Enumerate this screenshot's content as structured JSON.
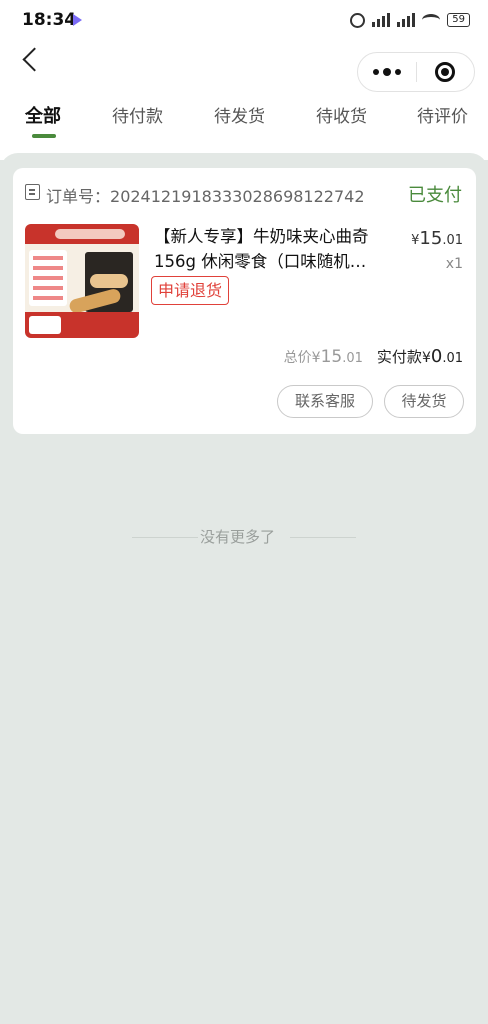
{
  "status_bar": {
    "time": "18:34",
    "battery": "59"
  },
  "tabs": [
    {
      "label": "全部",
      "active": true
    },
    {
      "label": "待付款",
      "active": false
    },
    {
      "label": "待发货",
      "active": false
    },
    {
      "label": "待收货",
      "active": false
    },
    {
      "label": "待评价",
      "active": false
    }
  ],
  "order": {
    "order_no_label": "订单号：",
    "order_no": "20241219183330286981227​42",
    "status": "已支付",
    "product_title": "【新人专享】牛奶味夹心曲奇156g 休闲零食（口味随机…",
    "price_symbol": "¥",
    "price_int": "15",
    "price_dec": ".01",
    "quantity": "x1",
    "refund_label": "申请退货",
    "total_label": "总价",
    "total_symbol": "¥",
    "total_int": "15",
    "total_dec": ".01",
    "paid_label": "实付款",
    "paid_symbol": "¥",
    "paid_int": "0",
    "paid_dec": ".01",
    "service_button": "联系客服",
    "status_button": "待发货"
  },
  "footer": {
    "no_more": "没有更多了"
  },
  "colors": {
    "accent": "#4a8a3c",
    "refund": "#e0413a",
    "background": "#e3e8e5"
  }
}
